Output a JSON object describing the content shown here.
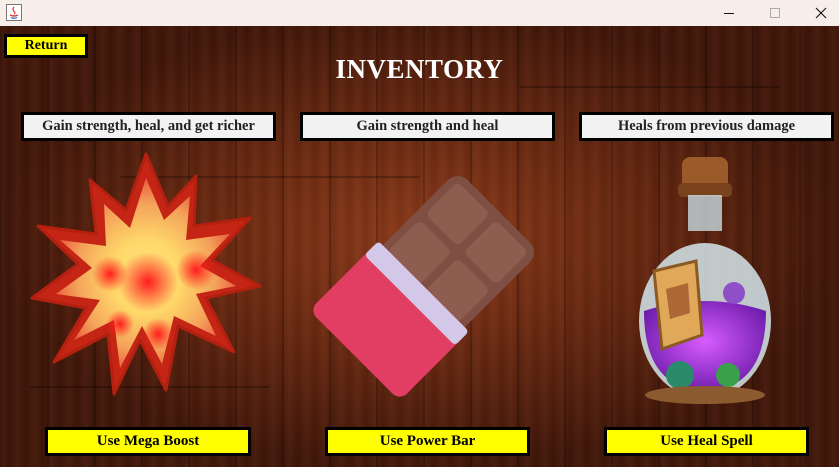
{
  "window": {
    "controls": {
      "minimize": "—",
      "maximize": "☐",
      "close": "✕"
    }
  },
  "header": {
    "return_label": "Return",
    "title": "INVENTORY"
  },
  "items": [
    {
      "description": "Gain strength, heal, and get richer",
      "use_label": "Use Mega Boost",
      "icon": "mega-boost-icon"
    },
    {
      "description": "Gain strength and heal",
      "use_label": "Use Power Bar",
      "icon": "chocolate-bar-icon"
    },
    {
      "description": "Heals from previous damage",
      "use_label": "Use Heal Spell",
      "icon": "potion-bottle-icon"
    }
  ],
  "colors": {
    "button_yellow": "#ffff00",
    "description_bg": "#f2f2f2",
    "wood_dark": "#3f160a",
    "wood_mid": "#8a3a1a"
  }
}
